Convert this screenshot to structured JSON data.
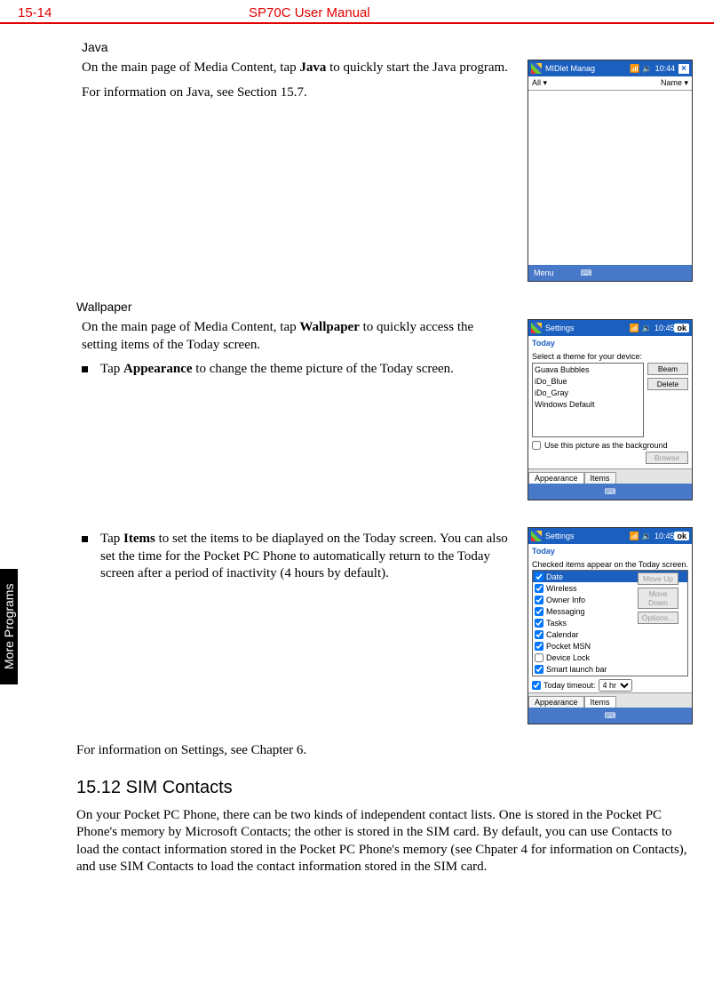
{
  "header": {
    "page_num": "15-14",
    "doc_title": "SP70C User Manual"
  },
  "side_tab": "More Programs",
  "java": {
    "title": "Java",
    "p1a": "On the main page of Media Content, tap ",
    "p1b": "Java",
    "p1c": " to quickly start the Java program.",
    "p2": "For information on Java, see Section 15.7.",
    "screen": {
      "title": "MIDlet Manag",
      "time": "10:44",
      "sub_left": "All ▾",
      "sub_right": "Name ▾",
      "menu": "Menu"
    }
  },
  "wallpaper": {
    "title": "Wallpaper",
    "p1a": "On the main page of Media Content, tap ",
    "p1b": "Wallpaper",
    "p1c": " to quickly access the setting items of the Today screen.",
    "b1a": "Tap ",
    "b1b": "Appearance",
    "b1c": " to change the theme picture of the Today screen.",
    "screen": {
      "title": "Settings",
      "time": "10:45",
      "ok": "ok",
      "today": "Today",
      "caption": "Select a theme for your device:",
      "themes": [
        "Guava Bubbles",
        "iDo_Blue",
        "iDo_Gray",
        "Windows Default"
      ],
      "btn_beam": "Beam",
      "btn_delete": "Delete",
      "use_pic": "Use this picture as the background",
      "browse": "Browse",
      "tab_appearance": "Appearance",
      "tab_items": "Items"
    }
  },
  "items": {
    "b1a": "Tap ",
    "b1b": "Items",
    "b1c": " to set the items to be diaplayed on the Today screen. You can also set the time for the Pocket PC Phone to automatically return to the Today screen after a period of inactivity (4 hours by default).",
    "screen": {
      "title": "Settings",
      "time": "10:45",
      "ok": "ok",
      "today": "Today",
      "caption": "Checked items appear on the Today screen.",
      "checks": [
        {
          "label": "Date",
          "checked": true,
          "sel": true
        },
        {
          "label": "Wireless",
          "checked": true
        },
        {
          "label": "Owner Info",
          "checked": true
        },
        {
          "label": "Messaging",
          "checked": true
        },
        {
          "label": "Tasks",
          "checked": true
        },
        {
          "label": "Calendar",
          "checked": true
        },
        {
          "label": "Pocket MSN",
          "checked": true
        },
        {
          "label": "Device Lock",
          "checked": false
        },
        {
          "label": "Smart launch bar",
          "checked": true
        }
      ],
      "btn_moveup": "Move Up",
      "btn_movedown": "Move Down",
      "btn_options": "Options...",
      "today_timeout_label": "Today timeout:",
      "today_timeout_value": "4 hr",
      "tab_appearance": "Appearance",
      "tab_items": "Items"
    },
    "closing": "For information on Settings, see Chapter 6."
  },
  "sim": {
    "heading": "15.12  SIM Contacts",
    "p": "On your Pocket PC Phone, there can be two kinds of independent contact lists. One is stored in the Pocket PC Phone's memory by Microsoft Contacts; the other is stored in the SIM card. By default, you can use Contacts to load the contact information stored in the Pocket PC Phone's memory (see Chpater 4 for information on Contacts), and use SIM Contacts to load the contact information stored in the SIM card."
  }
}
